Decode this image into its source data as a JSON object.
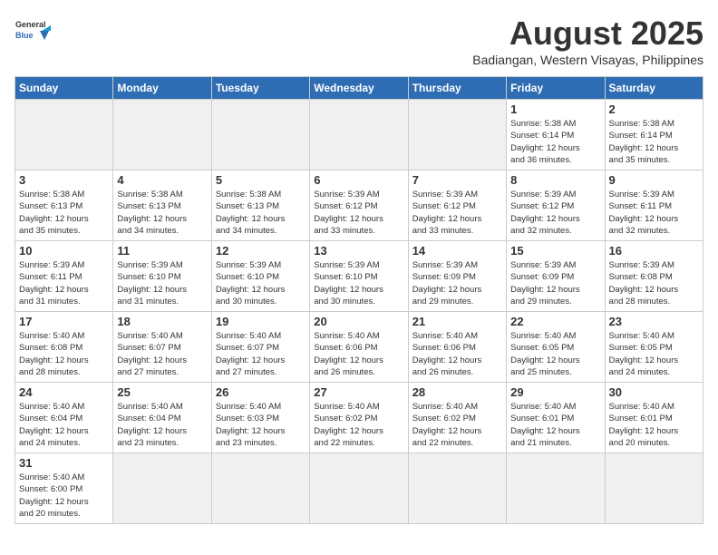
{
  "logo": {
    "text_general": "General",
    "text_blue": "Blue"
  },
  "header": {
    "title": "August 2025",
    "subtitle": "Badiangan, Western Visayas, Philippines"
  },
  "days_of_week": [
    "Sunday",
    "Monday",
    "Tuesday",
    "Wednesday",
    "Thursday",
    "Friday",
    "Saturday"
  ],
  "weeks": [
    [
      {
        "day": "",
        "info": "",
        "empty": true
      },
      {
        "day": "",
        "info": "",
        "empty": true
      },
      {
        "day": "",
        "info": "",
        "empty": true
      },
      {
        "day": "",
        "info": "",
        "empty": true
      },
      {
        "day": "",
        "info": "",
        "empty": true
      },
      {
        "day": "1",
        "info": "Sunrise: 5:38 AM\nSunset: 6:14 PM\nDaylight: 12 hours\nand 36 minutes."
      },
      {
        "day": "2",
        "info": "Sunrise: 5:38 AM\nSunset: 6:14 PM\nDaylight: 12 hours\nand 35 minutes."
      }
    ],
    [
      {
        "day": "3",
        "info": "Sunrise: 5:38 AM\nSunset: 6:13 PM\nDaylight: 12 hours\nand 35 minutes."
      },
      {
        "day": "4",
        "info": "Sunrise: 5:38 AM\nSunset: 6:13 PM\nDaylight: 12 hours\nand 34 minutes."
      },
      {
        "day": "5",
        "info": "Sunrise: 5:38 AM\nSunset: 6:13 PM\nDaylight: 12 hours\nand 34 minutes."
      },
      {
        "day": "6",
        "info": "Sunrise: 5:39 AM\nSunset: 6:12 PM\nDaylight: 12 hours\nand 33 minutes."
      },
      {
        "day": "7",
        "info": "Sunrise: 5:39 AM\nSunset: 6:12 PM\nDaylight: 12 hours\nand 33 minutes."
      },
      {
        "day": "8",
        "info": "Sunrise: 5:39 AM\nSunset: 6:12 PM\nDaylight: 12 hours\nand 32 minutes."
      },
      {
        "day": "9",
        "info": "Sunrise: 5:39 AM\nSunset: 6:11 PM\nDaylight: 12 hours\nand 32 minutes."
      }
    ],
    [
      {
        "day": "10",
        "info": "Sunrise: 5:39 AM\nSunset: 6:11 PM\nDaylight: 12 hours\nand 31 minutes."
      },
      {
        "day": "11",
        "info": "Sunrise: 5:39 AM\nSunset: 6:10 PM\nDaylight: 12 hours\nand 31 minutes."
      },
      {
        "day": "12",
        "info": "Sunrise: 5:39 AM\nSunset: 6:10 PM\nDaylight: 12 hours\nand 30 minutes."
      },
      {
        "day": "13",
        "info": "Sunrise: 5:39 AM\nSunset: 6:10 PM\nDaylight: 12 hours\nand 30 minutes."
      },
      {
        "day": "14",
        "info": "Sunrise: 5:39 AM\nSunset: 6:09 PM\nDaylight: 12 hours\nand 29 minutes."
      },
      {
        "day": "15",
        "info": "Sunrise: 5:39 AM\nSunset: 6:09 PM\nDaylight: 12 hours\nand 29 minutes."
      },
      {
        "day": "16",
        "info": "Sunrise: 5:39 AM\nSunset: 6:08 PM\nDaylight: 12 hours\nand 28 minutes."
      }
    ],
    [
      {
        "day": "17",
        "info": "Sunrise: 5:40 AM\nSunset: 6:08 PM\nDaylight: 12 hours\nand 28 minutes."
      },
      {
        "day": "18",
        "info": "Sunrise: 5:40 AM\nSunset: 6:07 PM\nDaylight: 12 hours\nand 27 minutes."
      },
      {
        "day": "19",
        "info": "Sunrise: 5:40 AM\nSunset: 6:07 PM\nDaylight: 12 hours\nand 27 minutes."
      },
      {
        "day": "20",
        "info": "Sunrise: 5:40 AM\nSunset: 6:06 PM\nDaylight: 12 hours\nand 26 minutes."
      },
      {
        "day": "21",
        "info": "Sunrise: 5:40 AM\nSunset: 6:06 PM\nDaylight: 12 hours\nand 26 minutes."
      },
      {
        "day": "22",
        "info": "Sunrise: 5:40 AM\nSunset: 6:05 PM\nDaylight: 12 hours\nand 25 minutes."
      },
      {
        "day": "23",
        "info": "Sunrise: 5:40 AM\nSunset: 6:05 PM\nDaylight: 12 hours\nand 24 minutes."
      }
    ],
    [
      {
        "day": "24",
        "info": "Sunrise: 5:40 AM\nSunset: 6:04 PM\nDaylight: 12 hours\nand 24 minutes."
      },
      {
        "day": "25",
        "info": "Sunrise: 5:40 AM\nSunset: 6:04 PM\nDaylight: 12 hours\nand 23 minutes."
      },
      {
        "day": "26",
        "info": "Sunrise: 5:40 AM\nSunset: 6:03 PM\nDaylight: 12 hours\nand 23 minutes."
      },
      {
        "day": "27",
        "info": "Sunrise: 5:40 AM\nSunset: 6:02 PM\nDaylight: 12 hours\nand 22 minutes."
      },
      {
        "day": "28",
        "info": "Sunrise: 5:40 AM\nSunset: 6:02 PM\nDaylight: 12 hours\nand 22 minutes."
      },
      {
        "day": "29",
        "info": "Sunrise: 5:40 AM\nSunset: 6:01 PM\nDaylight: 12 hours\nand 21 minutes."
      },
      {
        "day": "30",
        "info": "Sunrise: 5:40 AM\nSunset: 6:01 PM\nDaylight: 12 hours\nand 20 minutes."
      }
    ],
    [
      {
        "day": "31",
        "info": "Sunrise: 5:40 AM\nSunset: 6:00 PM\nDaylight: 12 hours\nand 20 minutes."
      },
      {
        "day": "",
        "info": "",
        "empty": true
      },
      {
        "day": "",
        "info": "",
        "empty": true
      },
      {
        "day": "",
        "info": "",
        "empty": true
      },
      {
        "day": "",
        "info": "",
        "empty": true
      },
      {
        "day": "",
        "info": "",
        "empty": true
      },
      {
        "day": "",
        "info": "",
        "empty": true
      }
    ]
  ]
}
